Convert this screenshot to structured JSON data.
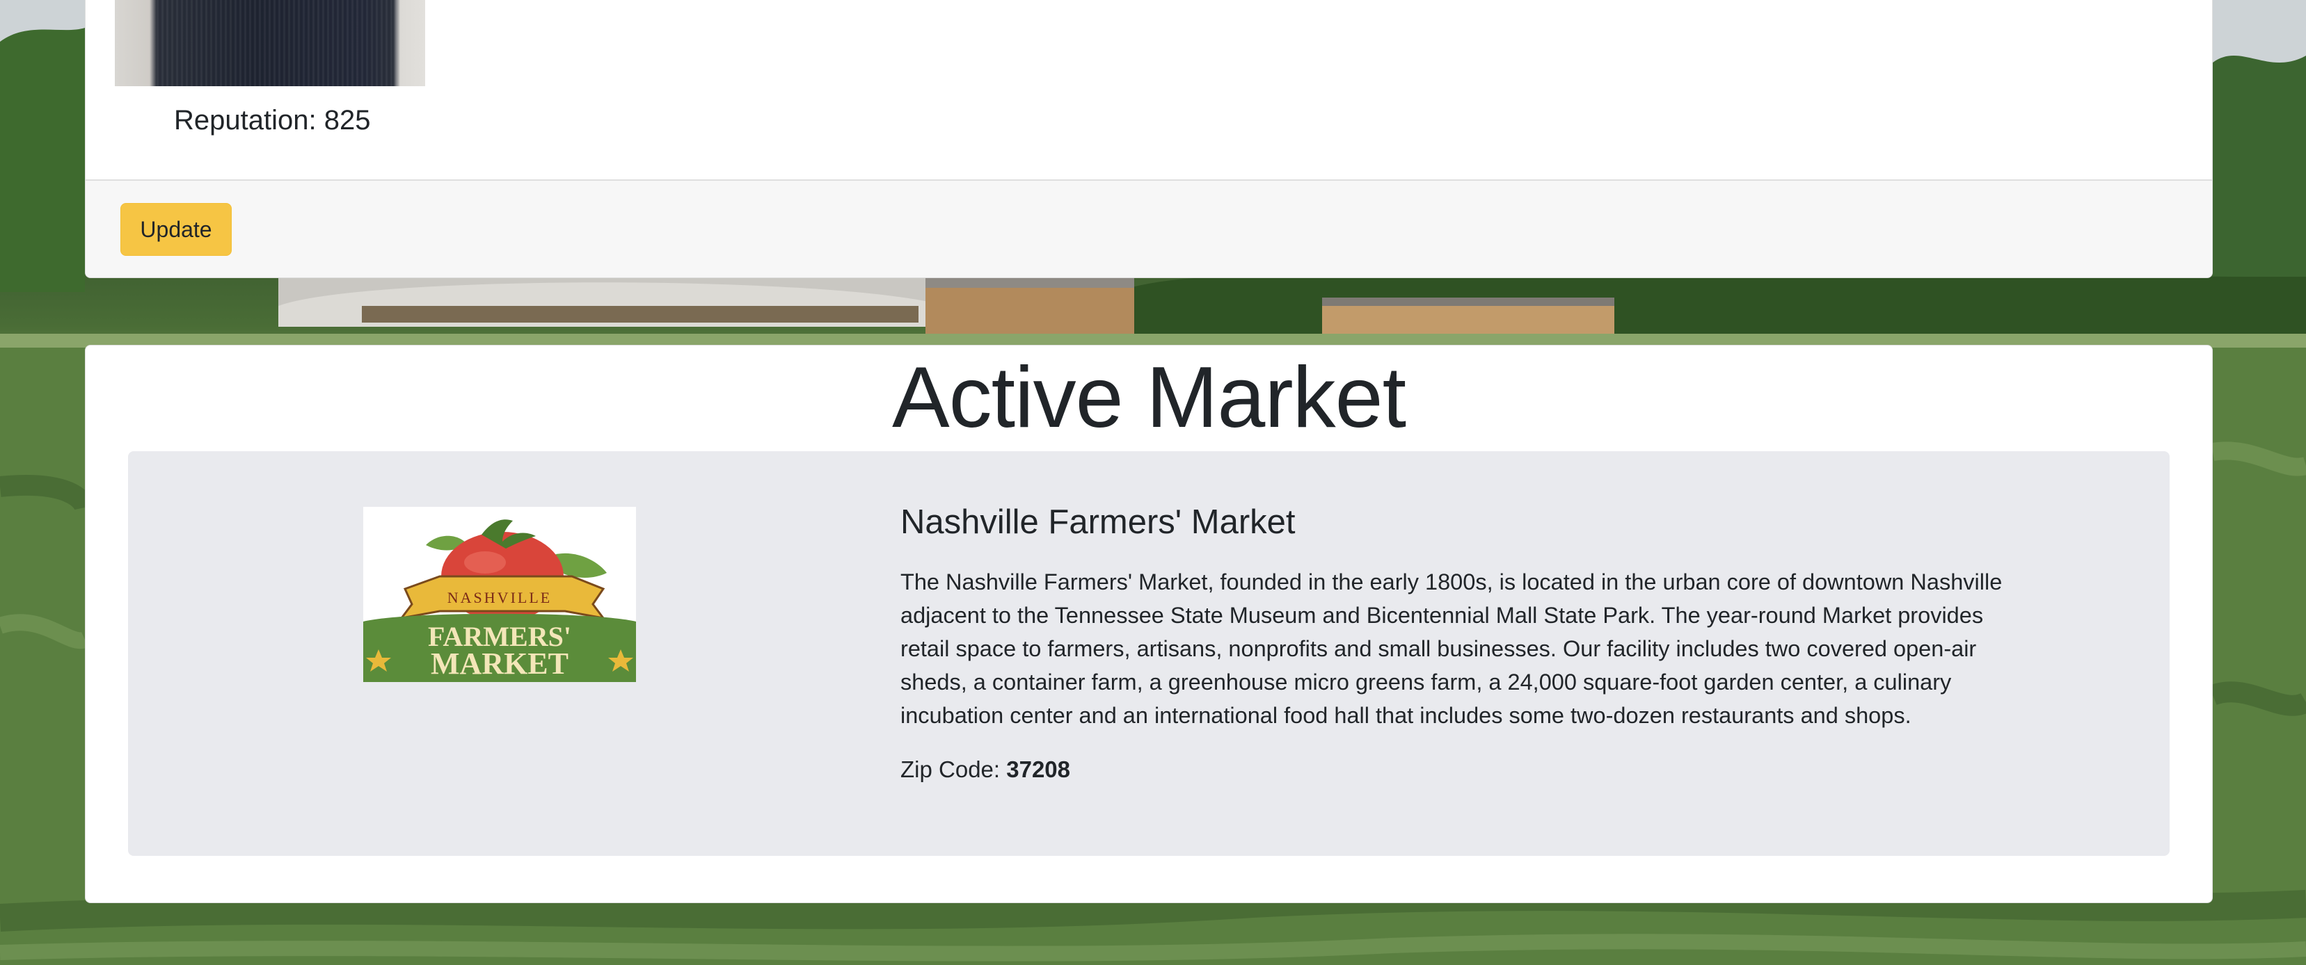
{
  "profile": {
    "reputation_label": "Reputation: 825",
    "update_label": "Update"
  },
  "active_market": {
    "section_title": "Active Market",
    "name": "Nashville Farmers' Market",
    "description": "The Nashville Farmers' Market, founded in the early 1800s, is located in the urban core of downtown Nashville adjacent to the Tennessee State Museum and Bicentennial Mall State Park. The year-round Market provides retail space to farmers, artisans, nonprofits and small businesses. Our facility includes two covered open-air sheds, a container farm, a greenhouse micro greens farm, a 24,000 square-foot garden center, a culinary incubation center and an international food hall that includes some two-dozen restaurants and shops.",
    "zip_label": "Zip Code: ",
    "zip_value": "37208",
    "logo": {
      "banner_text": "NASHVILLE",
      "line1": "FARMERS'",
      "line2": "MARKET"
    }
  },
  "colors": {
    "update_button": "#f6c544",
    "panel_background": "#e9eaee",
    "card_background": "#ffffff",
    "logo_tomato": "#d9453a",
    "logo_green": "#5b8c3a",
    "logo_banner": "#e9b93a"
  }
}
